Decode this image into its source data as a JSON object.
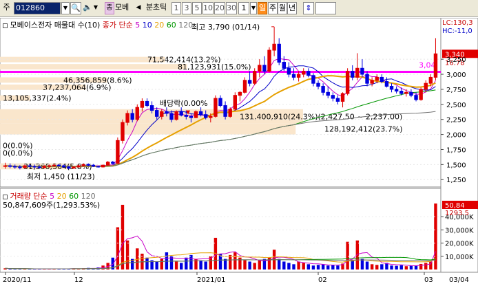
{
  "toolbar": {
    "mode": "주",
    "code": "012860",
    "name": "모베",
    "tick_label": "분초틱",
    "periods": [
      "1",
      "3",
      "5",
      "10",
      "20",
      "30"
    ],
    "count": "1",
    "units": [
      "일",
      "주",
      "월",
      "년"
    ]
  },
  "price_panel": {
    "legend_name": "모베이스전자 매물대 수(10)",
    "ma_label": "종가 단순",
    "ma_periods": [
      "5",
      "10",
      "20",
      "60",
      "120"
    ],
    "ma_colors": [
      "#c800c8",
      "#0000c8",
      "#e6a000",
      "#009600",
      "#707070"
    ],
    "lc_label": "LC:130,3",
    "hc_label": "HC:-11,0",
    "current_price": "3,340",
    "current_change": "16.78",
    "pink_line_label": "3,04",
    "high_note": "최고 3,790 (01/14)",
    "low_note": "최저 1,450 (11/23)",
    "dividend_note": "배당락(0.00%",
    "volume_profile": [
      {
        "text": "71,542,414(13.2%)",
        "value": 71542414
      },
      {
        "text": "81,123,931(15.0%)",
        "value": 81123931
      },
      {
        "text": "46,356,859(8.6%)",
        "value": 46356859
      },
      {
        "text": "37,237,064(6.9%)",
        "value": 37237064
      },
      {
        "text": "13,105,337(2.4%)",
        "value": 13105337
      },
      {
        "text": "131,400,910(24.3%)(2,427.50 ~ 2,237.00)",
        "value": 131400910
      },
      {
        "text": "128,192,412(23.7%)",
        "value": 128192412
      },
      {
        "text": "0(0.0%)",
        "value": 0
      },
      {
        "text": "0(0.0%)",
        "value": 0
      },
      {
        "text": "31,360,364(5.8%)",
        "value": 31360364
      }
    ],
    "y_ticks": [
      "3,250",
      "3,000",
      "2,750",
      "2,500",
      "2,250",
      "2,000",
      "1,750",
      "1,500",
      "1,250"
    ]
  },
  "volume_panel": {
    "legend_label": "거래량 단순",
    "ma_periods": [
      "5",
      "20",
      "60",
      "120"
    ],
    "ma_colors": [
      "#c800c8",
      "#e6a000",
      "#009600",
      "#707070"
    ],
    "stats": "50,847,609주(1,293.53%)",
    "current_volume": "50,84",
    "current_pct": "1293.5",
    "y_ticks": [
      "40,000K",
      "30,000K",
      "20,000K",
      "10,000K"
    ]
  },
  "x_axis": {
    "labels": [
      "2020/11",
      "12",
      "2021/01",
      "02",
      "03",
      "03/04"
    ]
  },
  "chart_data": {
    "type": "candlestick",
    "price_range": [
      1150,
      3800
    ],
    "volume_range": [
      0,
      50000
    ],
    "volume_unit": "K",
    "candles": [
      [
        1480,
        1530,
        1430,
        1480
      ],
      [
        1480,
        1520,
        1440,
        1470
      ],
      [
        1470,
        1500,
        1430,
        1460
      ],
      [
        1460,
        1490,
        1420,
        1450
      ],
      [
        1450,
        1500,
        1440,
        1480
      ],
      [
        1480,
        1510,
        1450,
        1470
      ],
      [
        1470,
        1500,
        1440,
        1460
      ],
      [
        1460,
        1480,
        1430,
        1450
      ],
      [
        1450,
        1490,
        1440,
        1470
      ],
      [
        1470,
        1500,
        1450,
        1480
      ],
      [
        1480,
        1520,
        1460,
        1490
      ],
      [
        1490,
        1510,
        1470,
        1480
      ],
      [
        1480,
        1500,
        1450,
        1460
      ],
      [
        1460,
        1480,
        1420,
        1440
      ],
      [
        1440,
        1470,
        1430,
        1460
      ],
      [
        1460,
        1500,
        1450,
        1480
      ],
      [
        1480,
        1520,
        1470,
        1500
      ],
      [
        1500,
        1520,
        1470,
        1490
      ],
      [
        1490,
        1510,
        1460,
        1470
      ],
      [
        1470,
        1480,
        1450,
        1460
      ],
      [
        1460,
        1500,
        1450,
        1490
      ],
      [
        1490,
        1560,
        1480,
        1540
      ],
      [
        1540,
        1560,
        1500,
        1520
      ],
      [
        1520,
        1950,
        1510,
        1900
      ],
      [
        1900,
        2250,
        1850,
        2200
      ],
      [
        2200,
        2400,
        2150,
        2350
      ],
      [
        2350,
        2420,
        2200,
        2250
      ],
      [
        2250,
        2500,
        2220,
        2450
      ],
      [
        2450,
        2600,
        2380,
        2550
      ],
      [
        2550,
        2600,
        2450,
        2480
      ],
      [
        2480,
        2550,
        2350,
        2400
      ],
      [
        2400,
        2450,
        2250,
        2300
      ],
      [
        2300,
        2420,
        2250,
        2380
      ],
      [
        2380,
        2450,
        2300,
        2350
      ],
      [
        2350,
        2400,
        2200,
        2250
      ],
      [
        2250,
        2400,
        2230,
        2380
      ],
      [
        2380,
        2450,
        2300,
        2320
      ],
      [
        2320,
        2400,
        2250,
        2300
      ],
      [
        2300,
        2350,
        2200,
        2280
      ],
      [
        2280,
        2400,
        2270,
        2380
      ],
      [
        2380,
        2450,
        2300,
        2330
      ],
      [
        2330,
        2400,
        2250,
        2280
      ],
      [
        2280,
        2350,
        2200,
        2300
      ],
      [
        2300,
        2650,
        2280,
        2600
      ],
      [
        2600,
        2650,
        2450,
        2480
      ],
      [
        2480,
        2550,
        2250,
        2300
      ],
      [
        2300,
        2450,
        2280,
        2420
      ],
      [
        2420,
        2700,
        2400,
        2650
      ],
      [
        2650,
        2720,
        2550,
        2700
      ],
      [
        2700,
        2950,
        2680,
        2900
      ],
      [
        2900,
        3050,
        2800,
        2850
      ],
      [
        2850,
        3100,
        2820,
        3050
      ],
      [
        3050,
        3250,
        2950,
        3150
      ],
      [
        3150,
        3300,
        3000,
        3050
      ],
      [
        3050,
        3450,
        3030,
        3400
      ],
      [
        3400,
        3790,
        3300,
        3500
      ],
      [
        3500,
        3600,
        3150,
        3200
      ],
      [
        3200,
        3300,
        3050,
        3100
      ],
      [
        3100,
        3200,
        2950,
        3000
      ],
      [
        3000,
        3100,
        2900,
        2950
      ],
      [
        2950,
        3050,
        2880,
        3000
      ],
      [
        3000,
        3100,
        2950,
        3050
      ],
      [
        3050,
        3100,
        2950,
        2980
      ],
      [
        2980,
        3020,
        2800,
        2850
      ],
      [
        2850,
        2900,
        2750,
        2800
      ],
      [
        2800,
        2850,
        2650,
        2700
      ],
      [
        2700,
        2800,
        2600,
        2650
      ],
      [
        2650,
        2700,
        2550,
        2600
      ],
      [
        2600,
        2650,
        2500,
        2550
      ],
      [
        2550,
        2700,
        2450,
        2680
      ],
      [
        2680,
        3100,
        2650,
        3050
      ],
      [
        3050,
        3150,
        2900,
        2950
      ],
      [
        2950,
        3350,
        2900,
        3100
      ],
      [
        3100,
        3250,
        2950,
        3000
      ],
      [
        3000,
        3050,
        2800,
        2850
      ],
      [
        2850,
        2950,
        2800,
        2900
      ],
      [
        2900,
        3000,
        2850,
        2950
      ],
      [
        2950,
        3000,
        2850,
        2880
      ],
      [
        2880,
        2950,
        2780,
        2800
      ],
      [
        2800,
        2850,
        2700,
        2750
      ],
      [
        2750,
        2800,
        2680,
        2720
      ],
      [
        2720,
        2780,
        2650,
        2680
      ],
      [
        2680,
        2750,
        2630,
        2700
      ],
      [
        2700,
        2750,
        2620,
        2650
      ],
      [
        2650,
        2700,
        2550,
        2580
      ],
      [
        2580,
        2780,
        2560,
        2750
      ],
      [
        2750,
        2900,
        2700,
        2850
      ],
      [
        2850,
        3000,
        2800,
        2950
      ],
      [
        2950,
        3600,
        2900,
        3340
      ]
    ],
    "volumes": [
      900,
      600,
      400,
      500,
      700,
      400,
      300,
      500,
      600,
      400,
      700,
      500,
      400,
      600,
      800,
      500,
      900,
      1200,
      700,
      1500,
      3000,
      5000,
      9000,
      32000,
      49000,
      22000,
      8000,
      16000,
      12000,
      9000,
      7000,
      6000,
      8000,
      13000,
      10000,
      6000,
      5000,
      9000,
      11000,
      8000,
      7000,
      6000,
      10000,
      24000,
      12000,
      8000,
      11000,
      13000,
      9000,
      7000,
      6000,
      5000,
      7000,
      8000,
      9000,
      15000,
      8000,
      6000,
      5000,
      4000,
      6000,
      5000,
      4000,
      3000,
      3500,
      4000,
      3000,
      3500,
      3000,
      4500,
      21000,
      7000,
      22000,
      8000,
      6000,
      4000,
      3500,
      4000,
      5000,
      3000,
      2800,
      3200,
      2500,
      3000,
      2800,
      4200,
      5000,
      6000,
      50847
    ]
  }
}
